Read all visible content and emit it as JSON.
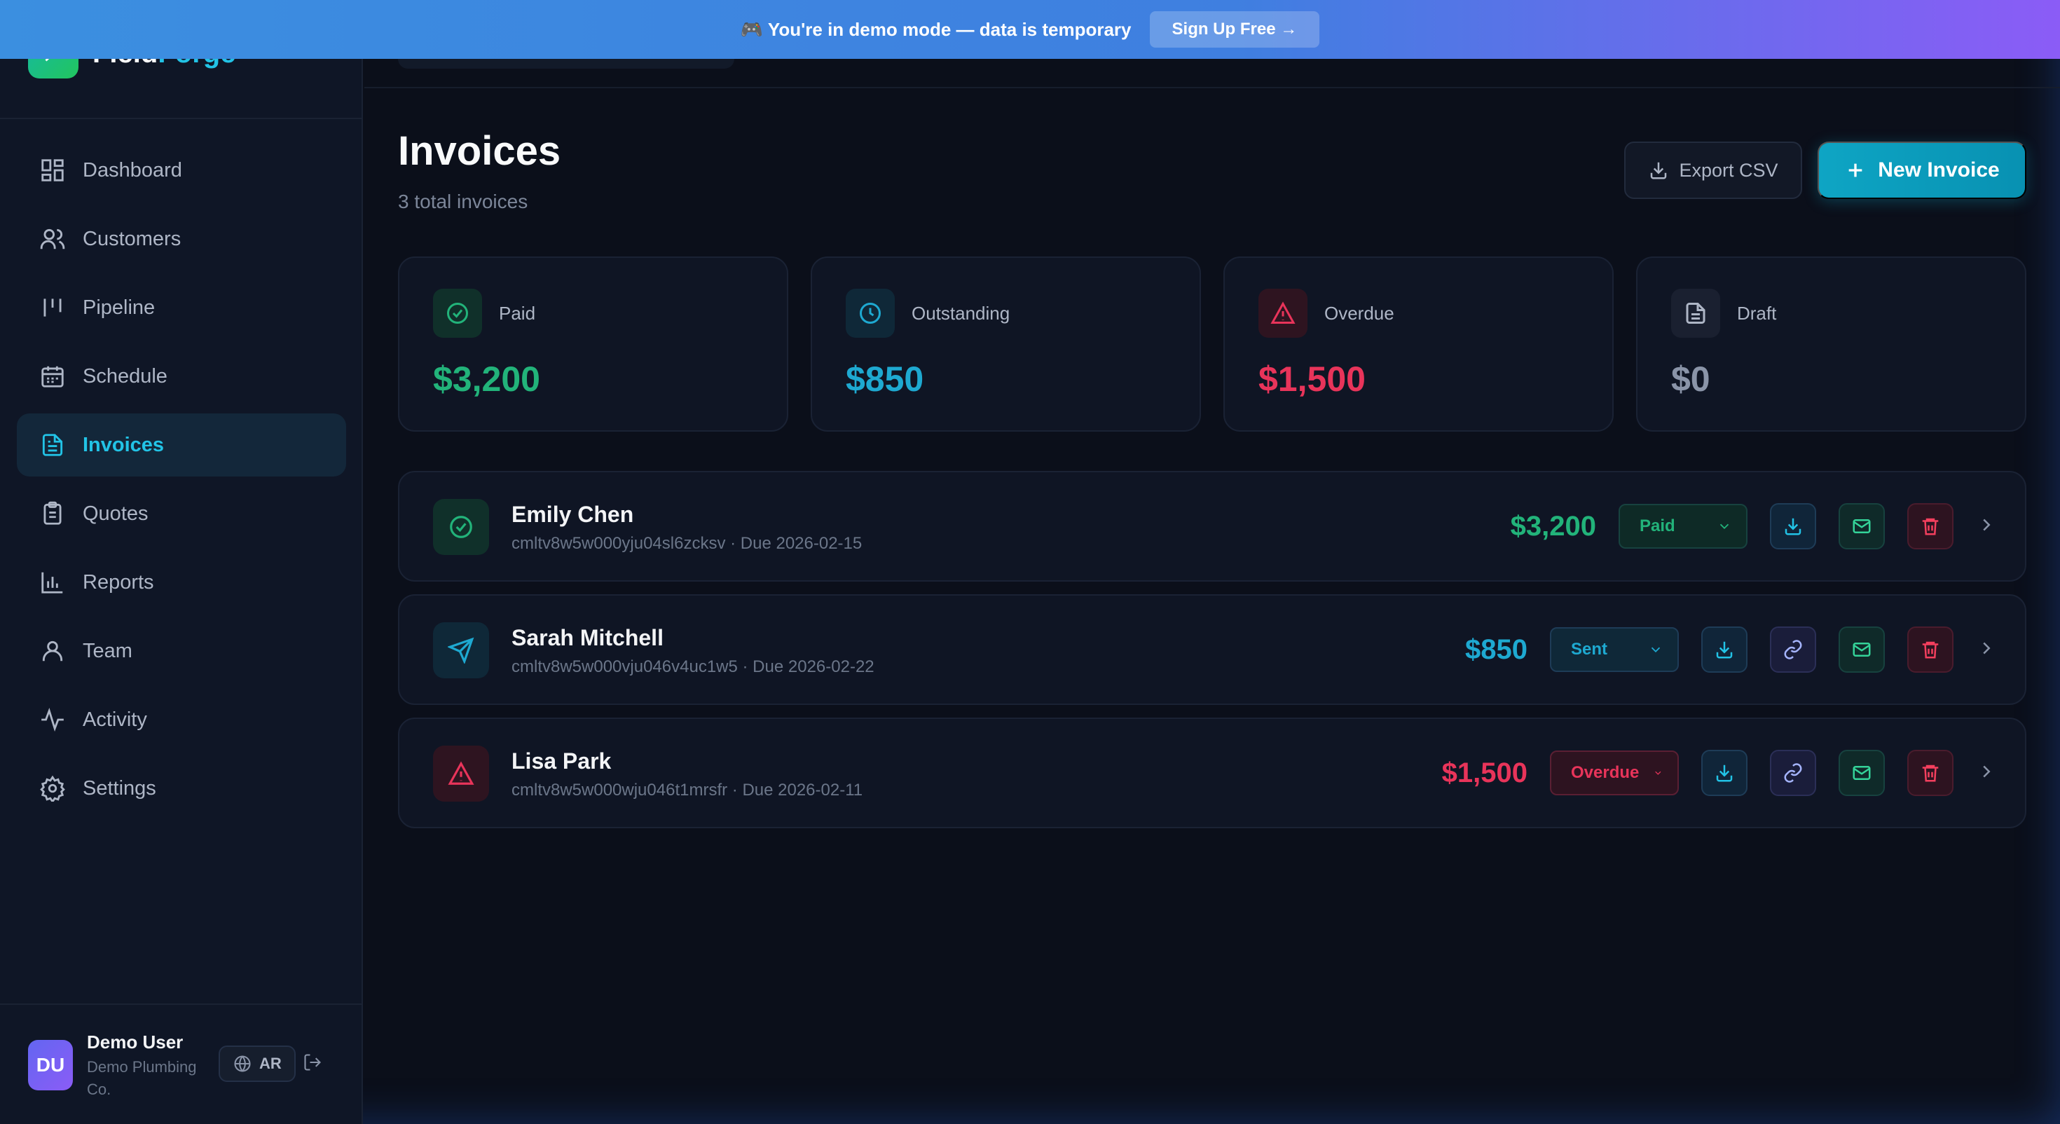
{
  "banner": {
    "text": "🎮 You're in demo mode — data is temporary",
    "button": "Sign Up Free →"
  },
  "brand": {
    "name_part1": "Field",
    "name_part2": "Forge"
  },
  "sidebar": {
    "items": [
      {
        "label": "Dashboard",
        "icon": "dashboard-icon"
      },
      {
        "label": "Customers",
        "icon": "users-icon"
      },
      {
        "label": "Pipeline",
        "icon": "pipeline-icon"
      },
      {
        "label": "Schedule",
        "icon": "calendar-icon"
      },
      {
        "label": "Invoices",
        "icon": "file-text-icon",
        "active": true
      },
      {
        "label": "Quotes",
        "icon": "clipboard-icon"
      },
      {
        "label": "Reports",
        "icon": "bar-chart-icon"
      },
      {
        "label": "Team",
        "icon": "user-icon"
      },
      {
        "label": "Activity",
        "icon": "activity-icon"
      },
      {
        "label": "Settings",
        "icon": "gear-icon"
      }
    ]
  },
  "user": {
    "initials": "DU",
    "name": "Demo User",
    "company": "Demo Plumbing Co.",
    "lang": "AR"
  },
  "page": {
    "title": "Invoices",
    "subtitle": "3 total invoices",
    "export_label": "Export CSV",
    "new_label": "New Invoice"
  },
  "stats": [
    {
      "label": "Paid",
      "value": "$3,200",
      "color": "#22b37a",
      "icon": "check-circle-icon"
    },
    {
      "label": "Outstanding",
      "value": "$850",
      "color": "#1ea9d1",
      "icon": "clock-icon"
    },
    {
      "label": "Overdue",
      "value": "$1,500",
      "color": "#e8345a",
      "icon": "alert-triangle-icon"
    },
    {
      "label": "Draft",
      "value": "$0",
      "color": "#8a94a8",
      "icon": "file-icon"
    }
  ],
  "invoices": [
    {
      "name": "Emily Chen",
      "id": "cmltv8w5w000yju04sl6zcksv",
      "due": "Due 2026-02-15",
      "amount": "$3,200",
      "status": "Paid"
    },
    {
      "name": "Sarah Mitchell",
      "id": "cmltv8w5w000vju046v4uc1w5",
      "due": "Due 2026-02-22",
      "amount": "$850",
      "status": "Sent"
    },
    {
      "name": "Lisa Park",
      "id": "cmltv8w5w000wju046t1mrsfr",
      "due": "Due 2026-02-11",
      "amount": "$1,500",
      "status": "Overdue"
    }
  ],
  "meta_sep": " · "
}
